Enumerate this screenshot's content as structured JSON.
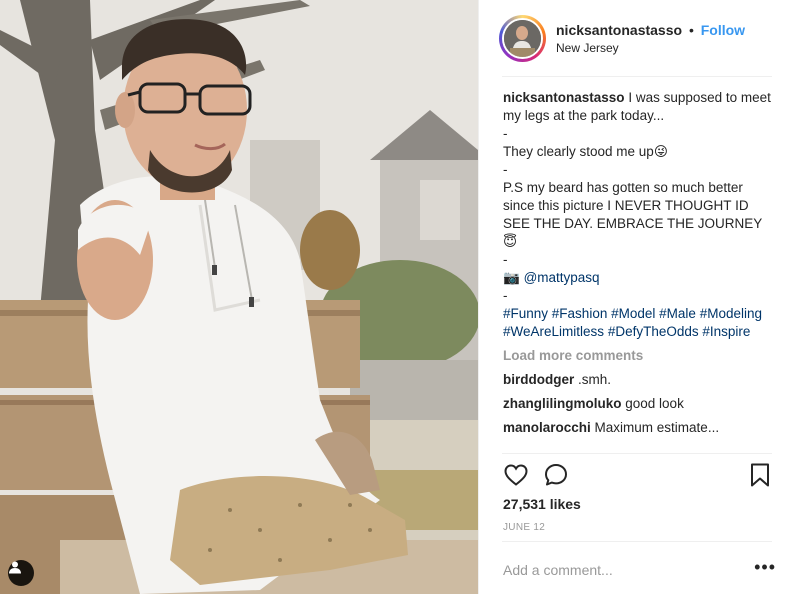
{
  "post": {
    "username": "nicksantonastasso",
    "separator": "•",
    "follow_label": "Follow",
    "location": "New Jersey"
  },
  "caption": {
    "username": "nicksantonastasso",
    "text_1": "I was supposed to meet my legs at the park today...",
    "dash_1": "-",
    "text_2": "They clearly stood me up😜",
    "dash_2": "-",
    "text_3": "P.S my beard has gotten so much better since this picture I NEVER THOUGHT ID SEE THE DAY. EMBRACE THE JOURNEY😇",
    "dash_3": "-",
    "camera_icon": "📷",
    "mention": "@mattypasq",
    "dash_4": "-",
    "hashtags": [
      "#Funny",
      "#Fashion",
      "#Model",
      "#Male",
      "#Modeling",
      "#WeAreLimitless",
      "#DefyTheOdds",
      "#Inspire"
    ]
  },
  "load_more_label": "Load more comments",
  "comments": [
    {
      "user": "birddodger",
      "text": ".smh."
    },
    {
      "user": "zhanglilingmoluko",
      "text": "good look"
    },
    {
      "user": "manolarocchi",
      "text": "Maximum estimate..."
    }
  ],
  "likes_label": "27,531 likes",
  "date_label": "JUNE 12",
  "add_comment_placeholder": "Add a comment...",
  "more_label": "•••",
  "icons": {
    "like": "heart-icon",
    "comment": "comment-bubble-icon",
    "save": "bookmark-icon",
    "tag": "user-tag-icon"
  },
  "colors": {
    "link_blue": "#3897f0",
    "hashtag_blue": "#003569",
    "muted": "#999999",
    "text": "#262626"
  }
}
